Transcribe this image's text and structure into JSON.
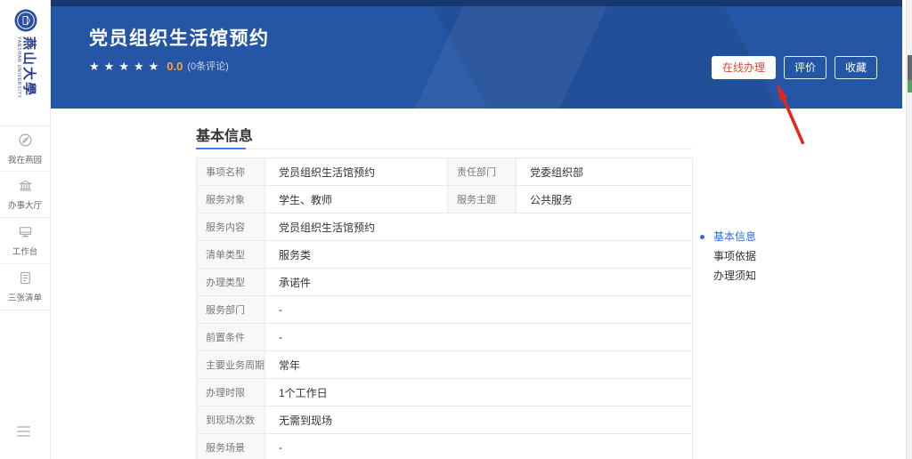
{
  "sidebar": {
    "logo": {
      "name_cn": "燕山大學",
      "name_en": "YANSHAN UNIVERSITY"
    },
    "items": [
      {
        "icon": "compass-icon",
        "label": "我在燕园"
      },
      {
        "icon": "hall-icon",
        "label": "办事大厅"
      },
      {
        "icon": "workbench-icon",
        "label": "工作台"
      },
      {
        "icon": "list-icon",
        "label": "三张清单"
      }
    ]
  },
  "banner": {
    "title": "党员组织生活馆预约",
    "rating": {
      "stars_count": 5,
      "score": "0.0",
      "reviews_label": "(0条评论)"
    },
    "actions": [
      {
        "label": "在线办理",
        "style": "primary"
      },
      {
        "label": "评价",
        "style": "ghost"
      },
      {
        "label": "收藏",
        "style": "ghost"
      }
    ]
  },
  "main": {
    "section_title": "基本信息",
    "info_table": {
      "rows": [
        {
          "cells": [
            {
              "label": "事项名称",
              "value": "党员组织生活馆预约"
            },
            {
              "label": "责任部门",
              "value": "党委组织部"
            }
          ]
        },
        {
          "cells": [
            {
              "label": "服务对象",
              "value": "学生、教师"
            },
            {
              "label": "服务主题",
              "value": "公共服务"
            }
          ]
        },
        {
          "cells": [
            {
              "label": "服务内容",
              "value": "党员组织生活馆预约"
            }
          ]
        },
        {
          "cells": [
            {
              "label": "清单类型",
              "value": "服务类"
            }
          ]
        },
        {
          "cells": [
            {
              "label": "办理类型",
              "value": "承诺件"
            }
          ]
        },
        {
          "cells": [
            {
              "label": "服务部门",
              "value": "-"
            }
          ]
        },
        {
          "cells": [
            {
              "label": "前置条件",
              "value": "-"
            }
          ]
        },
        {
          "cells": [
            {
              "label": "主要业务周期",
              "value": "常年"
            }
          ]
        },
        {
          "cells": [
            {
              "label": "办理时限",
              "value": "1个工作日"
            }
          ]
        },
        {
          "cells": [
            {
              "label": "到现场次数",
              "value": "无需到现场"
            }
          ]
        },
        {
          "cells": [
            {
              "label": "服务场景",
              "value": "-"
            }
          ]
        }
      ]
    },
    "anchor_nav": [
      {
        "label": "基本信息",
        "active": true
      },
      {
        "label": "事项依据",
        "active": false
      },
      {
        "label": "办理须知",
        "active": false
      }
    ]
  },
  "colors": {
    "banner_blue": "#2456a5",
    "banner_top_strip": "#17376f",
    "primary_button_text": "#dd4a2c",
    "score_orange": "#ffa13d",
    "active_link_blue": "#2e6bdf",
    "section_underline_blue": "#3d7ef2",
    "annotation_arrow_red": "#e4261c"
  }
}
